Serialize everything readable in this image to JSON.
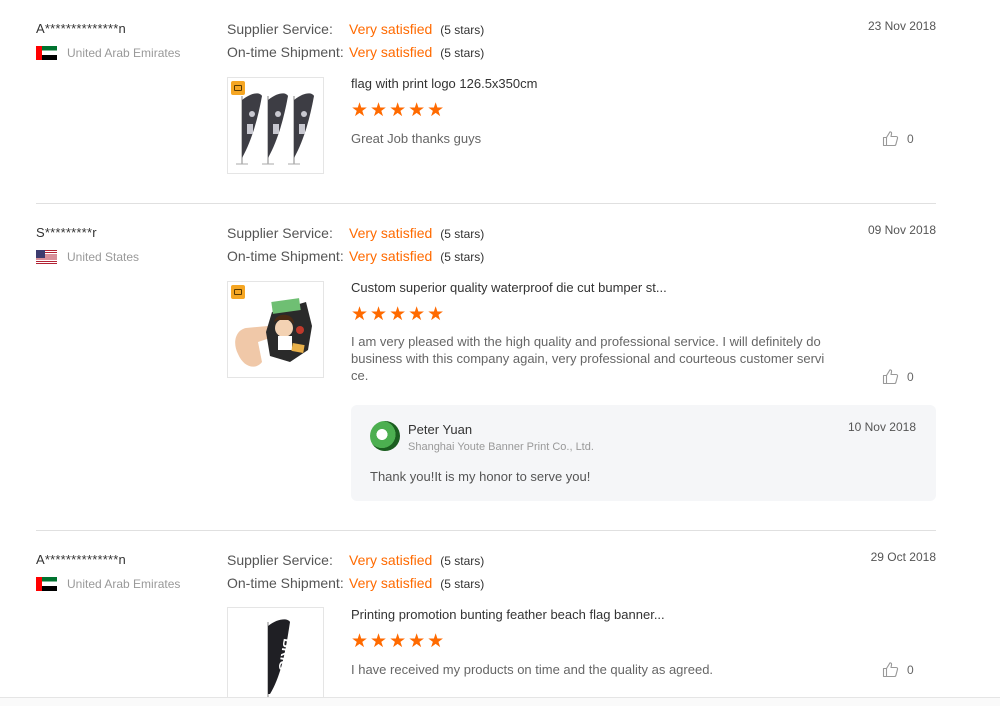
{
  "labels": {
    "supplier_service": "Supplier Service:",
    "ontime_shipment": "On-time Shipment:"
  },
  "accent_color": "#ff6a00",
  "reviews": [
    {
      "buyer": "A**************n",
      "country": "United Arab Emirates",
      "flag": "uae-flag",
      "supplier_service": "Very satisfied",
      "supplier_stars": "(5 stars)",
      "shipment": "Very satisfied",
      "shipment_stars": "(5 stars)",
      "date": "23 Nov 2018",
      "product": "flag with print logo 126.5x350cm",
      "rating": "★★★★★",
      "text": "Great Job thanks guys",
      "likes": "0"
    },
    {
      "buyer": "S*********r",
      "country": "United States",
      "flag": "us-flag",
      "supplier_service": "Very satisfied",
      "supplier_stars": "(5 stars)",
      "shipment": "Very satisfied",
      "shipment_stars": "(5 stars)",
      "date": "09 Nov 2018",
      "product": "Custom superior quality waterproof die cut bumper st...",
      "rating": "★★★★★",
      "text": "I am very pleased with the high quality and professional service.  I will definitely do business with this company again, very professional and courteous customer service.",
      "likes": "0",
      "reply": {
        "name": "Peter Yuan",
        "company": "Shanghai Youte Banner Print Co., Ltd.",
        "date": "10 Nov 2018",
        "text": "Thank you!It is my honor to serve you!"
      }
    },
    {
      "buyer": "A**************n",
      "country": "United Arab Emirates",
      "flag": "uae-flag",
      "supplier_service": "Very satisfied",
      "supplier_stars": "(5 stars)",
      "shipment": "Very satisfied",
      "shipment_stars": "(5 stars)",
      "date": "29 Oct 2018",
      "product": "Printing promotion bunting feather beach flag banner...",
      "rating": "★★★★★",
      "text": "I have received my products on time and the quality as agreed.",
      "likes": "0",
      "flag_print": "BRIG"
    }
  ]
}
